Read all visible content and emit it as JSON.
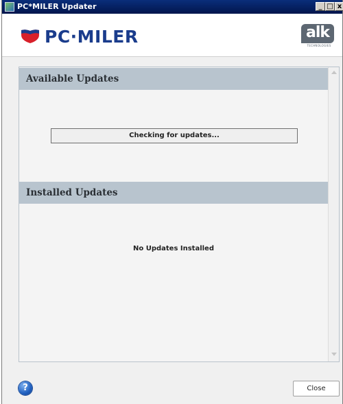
{
  "window": {
    "title": "PC*MILER Updater",
    "controls": {
      "minimize": "_",
      "maximize": "□",
      "close": "x"
    }
  },
  "header": {
    "product_logo_text": "PC·MILER",
    "vendor_logo_text": "alk",
    "vendor_logo_sub": "TECHNOLOGIES"
  },
  "available": {
    "heading": "Available Updates",
    "status_text": "Checking for updates..."
  },
  "installed": {
    "heading": "Installed Updates",
    "empty_text": "No Updates Installed"
  },
  "footer": {
    "help_icon": "help-icon",
    "help_glyph": "?",
    "close_label": "Close"
  },
  "colors": {
    "titlebar": "#0a2e7a",
    "section_header": "#b8c4ce",
    "brand_blue": "#1a3c8c",
    "brand_red": "#d8202a"
  }
}
